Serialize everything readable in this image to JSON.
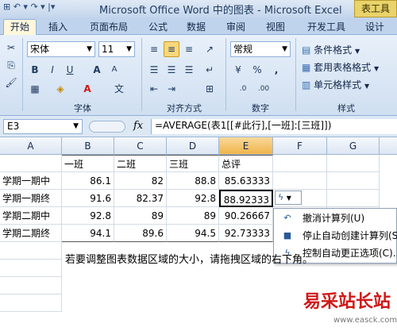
{
  "titlebar": {
    "quick_access": "⊞  ↶ ▾  ↷ ▾  |▾",
    "title": "Microsoft Office Word 中的图表 - Microsoft Excel",
    "context_tab": "表工具"
  },
  "tabs": [
    "开始",
    "插入",
    "页面布局",
    "公式",
    "数据",
    "审阅",
    "视图",
    "开发工具",
    "设计"
  ],
  "active_tab": "开始",
  "ribbon": {
    "font_name": "宋体",
    "font_size": "11",
    "bold": "B",
    "italic": "I",
    "underline": "U",
    "grow_font": "A",
    "shrink_font": "A",
    "font_color_letter": "A",
    "font_group": "字体",
    "alignment_group": "对齐方式",
    "number_format": "常规",
    "percent": "%",
    "comma": ",",
    "number_group": "数字",
    "conditional_format": "条件格式",
    "table_format": "套用表格格式",
    "cell_styles": "单元格样式",
    "styles_group": "样式"
  },
  "formula_bar": {
    "name_box": "E3",
    "fx": "fx",
    "formula": "=AVERAGE(表1[[#此行],[一班]:[三班]])"
  },
  "columns": [
    "A",
    "B",
    "C",
    "D",
    "E",
    "F",
    "G"
  ],
  "header_row": [
    "",
    "一班",
    "二班",
    "三班",
    "总评"
  ],
  "rows": [
    [
      "学期一期中",
      "86.1",
      "82",
      "88.8",
      "85.63333"
    ],
    [
      "学期一期终",
      "91.6",
      "82.37",
      "92.8",
      "88.92333"
    ],
    [
      "学期二期中",
      "92.8",
      "89",
      "89",
      "90.26667"
    ],
    [
      "学期二期终",
      "94.1",
      "89.6",
      "94.5",
      "92.73333"
    ]
  ],
  "autocorrect_menu": [
    "撤消计算列(U)",
    "停止自动创建计算列(S)",
    "控制自动更正选项(C)..."
  ],
  "note": "若要调整图表数据区域的大小，请拖拽区域的右下角。",
  "watermark": {
    "logo": "易采站长站",
    "url": "www.easck.com"
  }
}
